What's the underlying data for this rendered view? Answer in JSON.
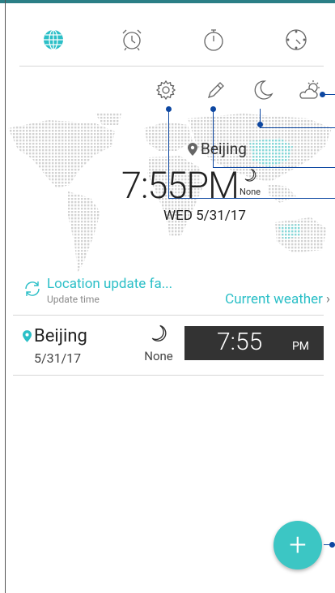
{
  "tabs": [
    {
      "name": "world-clock",
      "icon": "globe-icon",
      "active": true
    },
    {
      "name": "alarm",
      "icon": "alarm-clock-icon",
      "active": false
    },
    {
      "name": "stopwatch",
      "icon": "stopwatch-icon",
      "active": false
    },
    {
      "name": "timer",
      "icon": "timer-icon",
      "active": false
    }
  ],
  "actions": [
    {
      "name": "settings",
      "icon": "gear-icon"
    },
    {
      "name": "edit",
      "icon": "pencil-icon"
    },
    {
      "name": "night-mode",
      "icon": "moon-icon"
    },
    {
      "name": "weather",
      "icon": "partly-cloudy-icon"
    }
  ],
  "home": {
    "city": "Beijing",
    "time": "7:55PM",
    "weather_label": "None",
    "date": "WED 5/31/17"
  },
  "location": {
    "status": "Location update fa...",
    "sub_label": "Update time",
    "current_weather_link": "Current weather"
  },
  "clocks": [
    {
      "city": "Beijing",
      "date": "5/31/17",
      "weather_label": "None",
      "time": "7:55",
      "ampm": "PM"
    }
  ],
  "fab": {
    "label": "+"
  },
  "colors": {
    "accent": "#2bbfc7",
    "fab": "#3cc6c4",
    "status_strip": "#2b7f86",
    "callout": "#0d47a1",
    "clock_box": "#333333"
  }
}
